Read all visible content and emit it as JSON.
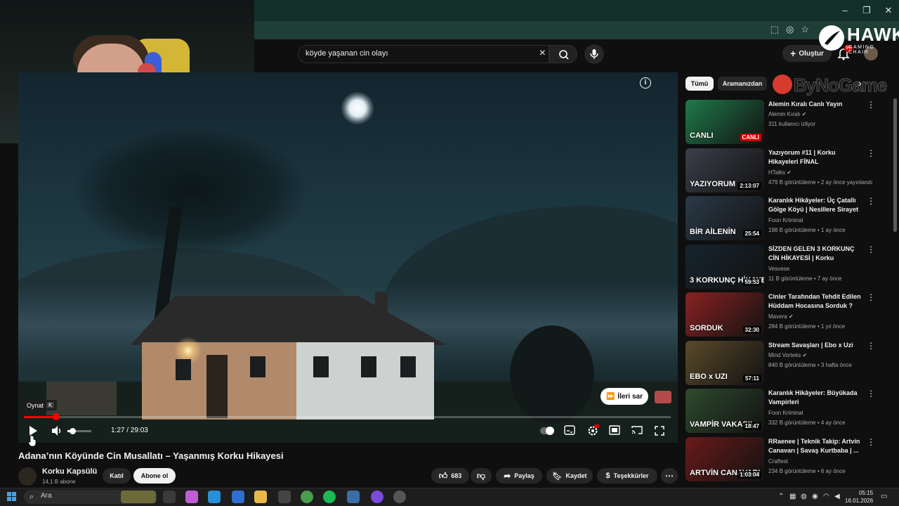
{
  "window": {
    "minimize": "–",
    "restore": "❐",
    "close": "✕"
  },
  "header": {
    "search_value": "köyde yaşanan cin olayı",
    "create_label": "Oluştur",
    "notification_count": "9+"
  },
  "overlays": {
    "hawk_logo": "HAWK",
    "hawk_sub": "GAMING CHAIR",
    "bynogame": "ByNoGame"
  },
  "player": {
    "tooltip_label": "Oynat",
    "tooltip_key": "K",
    "time": "1:27 / 29:03",
    "progress_fraction": 0.05,
    "volume_fraction": 0.2,
    "skip_label": "İleri sar"
  },
  "video": {
    "title": "Adana’nın Köyünde Cin Musallatı – Yaşanmış Korku Hikayesi",
    "channel": "Korku Kapsülü",
    "subscribers": "14,1 B abone",
    "join_label": "Katıl",
    "subscribe_label": "Abone ol",
    "likes": "683",
    "share_label": "Paylaş",
    "save_label": "Kaydet",
    "thanks_label": "Teşekkürler"
  },
  "chips": [
    "Tümü",
    "Aramanızdan"
  ],
  "recommendations": [
    {
      "title": "Alemin Kıralı Canlı Yayın",
      "channel": "Alemin Kıralı",
      "verified": true,
      "meta": "311 kullanıcı izliyor",
      "badge": "CANLI",
      "live": true,
      "thumb_label": "CANLI",
      "thumb_color": "#1f7a4a"
    },
    {
      "title": "Yazıyorum #11 | Korku Hikayeleri FİNAL",
      "channel": "HTalks",
      "verified": true,
      "meta": "479 B görüntüleme • 2 ay önce yayınlandı",
      "badge": "2:13:07",
      "live": false,
      "thumb_label": "YAZIYORUM",
      "thumb_color": "#3b3f4a"
    },
    {
      "title": "Karanlık Hikâyeler: Üç Çatallı Gölge Köyü | Nesillere Sirayet ...",
      "channel": "Foon Kriminal",
      "verified": false,
      "meta": "198 B görüntüleme • 1 ay önce",
      "badge": "25:54",
      "live": false,
      "thumb_label": "BİR AİLENİN",
      "thumb_color": "#2a3a48"
    },
    {
      "title": "SİZDEN GELEN 3 KORKUNÇ CİN HİKAYESİ | Korku Hikayeleri",
      "channel": "Vesvese",
      "verified": false,
      "meta": "11 B görüntüleme • 7 ay önce",
      "badge": "59:53",
      "live": false,
      "thumb_label": "3 KORKUNÇ HİKAYE",
      "thumb_color": "#16242e"
    },
    {
      "title": "Cinler Tarafından Tehdit Edilen Hüddam Hocasına Sorduk ?",
      "channel": "Mavera",
      "verified": true,
      "meta": "284 B görüntüleme • 1 yıl önce",
      "badge": "32:30",
      "live": false,
      "thumb_label": "SORDUK",
      "thumb_color": "#8a2222"
    },
    {
      "title": "Stream Savaşları | Ebo x Uzi",
      "channel": "Mind Vorteks",
      "verified": true,
      "meta": "840 B görüntüleme • 3 hafta önce",
      "badge": "57:11",
      "live": false,
      "thumb_label": "EBO x UZI",
      "thumb_color": "#5a4a2a"
    },
    {
      "title": "Karanlık Hikâyeler: Büyükada Vampirleri",
      "channel": "Foon Kriminal",
      "verified": false,
      "meta": "332 B görüntüleme • 4 ay önce",
      "badge": "18:47",
      "live": false,
      "thumb_label": "VAMPİR VAKASI!",
      "thumb_color": "#2e4a2e"
    },
    {
      "title": "RRaenee | Teknik Takip: Artvin Canavarı | Savaş Kurtbaba | ...",
      "channel": "Craftest",
      "verified": false,
      "meta": "234 B görüntüleme • 6 ay önce",
      "badge": "1:03:04",
      "live": false,
      "thumb_label": "ARTVİN CANAVARI",
      "thumb_color": "#6a1a1a"
    }
  ],
  "taskbar": {
    "search_label": "Ara",
    "time": "05:15",
    "date": "16.01.2026"
  },
  "colors": {
    "accent": "#ff0000",
    "background": "#0f0f0f",
    "browser_frame": "#1c3a32"
  }
}
